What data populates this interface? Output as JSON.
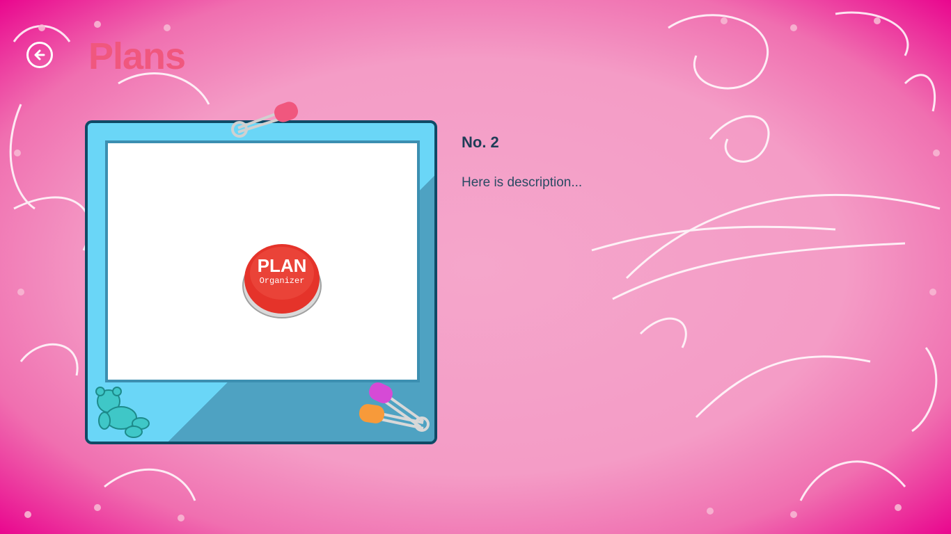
{
  "header": {
    "title": "Plans",
    "back_icon": "back-arrow-icon"
  },
  "item": {
    "image_title": "PLAN",
    "image_subtitle": "Organizer",
    "number_label": "No. 2",
    "description": "Here is description..."
  },
  "colors": {
    "background": "#f49cc6",
    "border_pink": "#e9068e",
    "title": "#f0577e",
    "frame": "#4ea2c2",
    "frame_light": "#6ad6f7",
    "frame_border": "#0f4a66",
    "text_dark": "#1f3d57"
  },
  "icons": {
    "top_pin": "safety-pin-icon",
    "bottom_pins": "safety-pins-icon",
    "teddy": "teddy-bear-icon"
  }
}
